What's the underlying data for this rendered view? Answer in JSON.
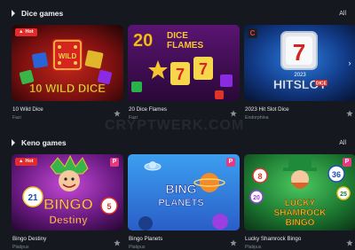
{
  "watermark": "CRYPTWERK.COM",
  "sections": [
    {
      "title": "Dice games",
      "all_label": "All",
      "games": [
        {
          "name": "10 Wild Dice",
          "provider": "Fazi",
          "art_title": "10 WILD DICE",
          "art_wild": "WILD",
          "badge": "Hot"
        },
        {
          "name": "20 Dice Flames",
          "provider": "Fazi",
          "art_number": "20",
          "art_title_top": "DICE",
          "art_title_bottom": "FLAMES"
        },
        {
          "name": "2023 Hit Slot Dice",
          "provider": "Endorphina",
          "art_year": "2023",
          "art_title": "HITSLOT",
          "art_dice": "DICE",
          "art_seven": "7",
          "badge": "C"
        }
      ]
    },
    {
      "title": "Keno games",
      "all_label": "All",
      "games": [
        {
          "name": "Bingo Destiny",
          "provider": "Platipus",
          "art_title": "BINGO",
          "art_sub": "Destiny",
          "art_n1": "21",
          "art_n2": "5",
          "badge": "Hot",
          "badge_p": "P"
        },
        {
          "name": "Bingo Planets",
          "provider": "Platipus",
          "art_title": "BING",
          "art_sub": "PLANETS",
          "badge_p": "P"
        },
        {
          "name": "Lucky Shamrock Bingo",
          "provider": "Platipus",
          "art_title1": "LUCKY",
          "art_title2": "SHAMROCK",
          "art_title3": "BINGO",
          "art_n1": "8",
          "art_n2": "36",
          "art_n3": "25",
          "art_n4": "20",
          "badge_p": "P"
        }
      ]
    }
  ],
  "colors": {
    "background": "#15191f",
    "hot_badge": "#e32b2b",
    "provider_badge": "#e53a82"
  }
}
